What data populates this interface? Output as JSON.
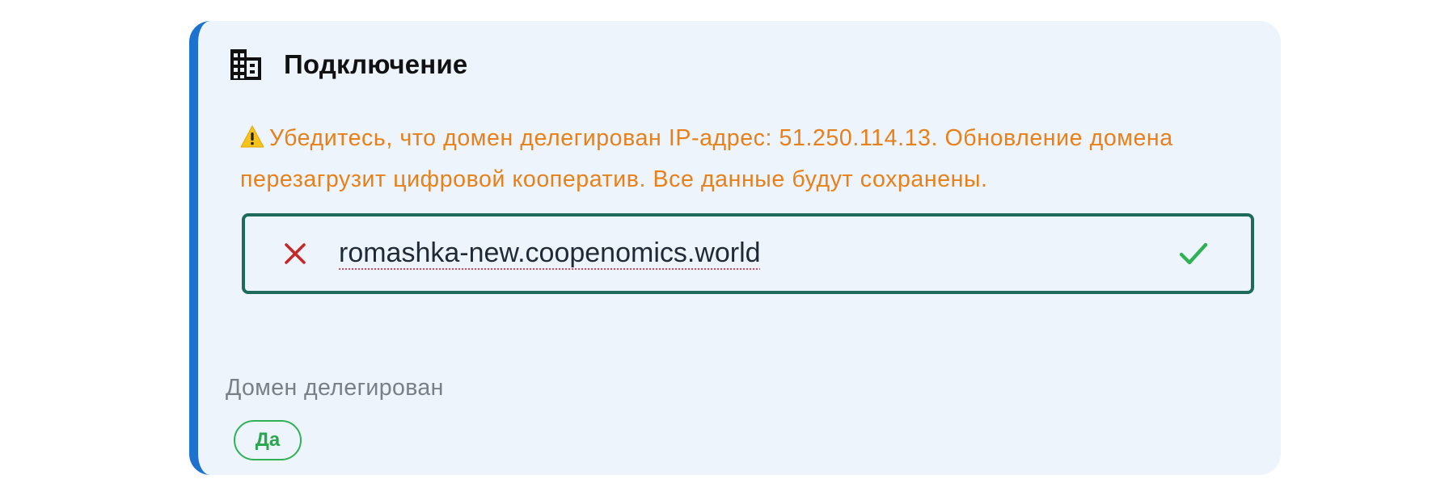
{
  "connection": {
    "title": "Подключение",
    "header_icon": "building-icon",
    "warning": {
      "icon": "warning-icon",
      "text": "Убедитесь, что домен делегирован IP-адрес: 51.250.114.13. Обновление домена перезагрузит цифровой кооператив. Все данные будут сохранены."
    },
    "domain_input": {
      "value": "romashka-new.coopenomics.world",
      "clear_icon": "close-icon",
      "confirm_icon": "check-icon"
    },
    "delegated": {
      "label": "Домен делегирован",
      "value": "Да"
    }
  },
  "colors": {
    "accent": "#1e72cf",
    "card_background": "#edf4fb",
    "warning_text": "#e8801a",
    "input_border": "#1e6b5c",
    "clear_icon": "#c62828",
    "confirm_icon": "#2fb155",
    "badge": "#2fb155"
  }
}
